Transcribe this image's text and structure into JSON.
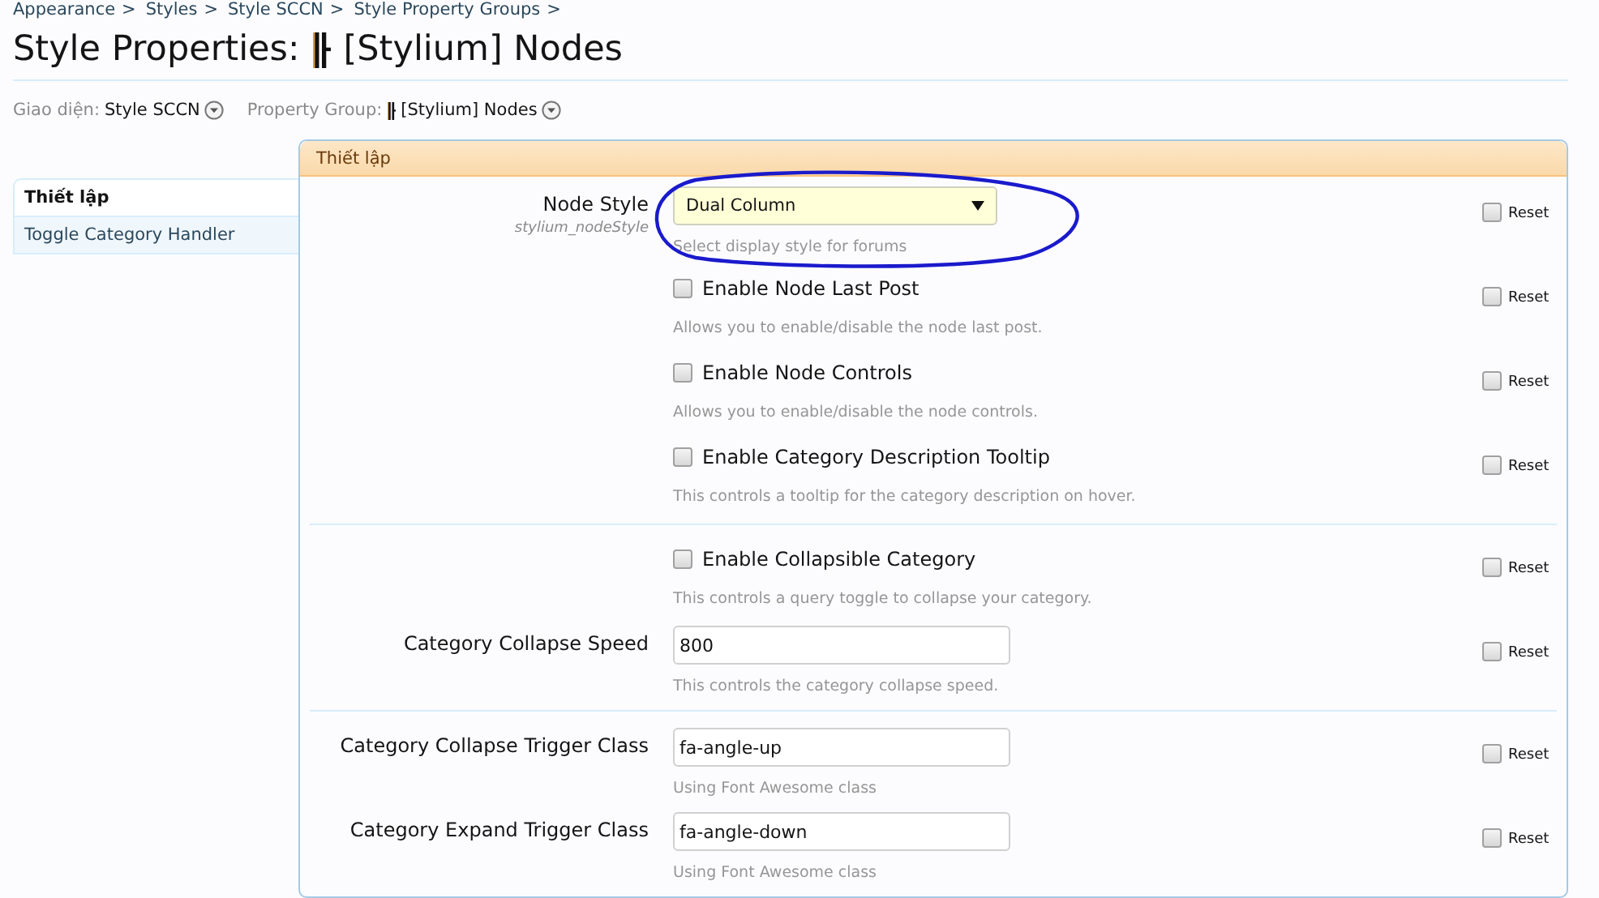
{
  "breadcrumbs": {
    "separator": ">",
    "items": [
      "Appearance",
      "Styles",
      "Style SCCN",
      "Style Property Groups"
    ]
  },
  "title": {
    "prefix": "Style Properties:",
    "group": "[Stylium] Nodes"
  },
  "filters": [
    {
      "kind": "style",
      "label": "Giao diện:",
      "value": "Style SCCN"
    },
    {
      "kind": "group",
      "label": "Property Group:",
      "value": "[Stylium] Nodes"
    }
  ],
  "sidebar": {
    "tabs": [
      {
        "label": "Thiết lập",
        "selected": true
      },
      {
        "label": "Toggle Category Handler",
        "selected": false
      }
    ]
  },
  "panel": {
    "header": "Thiết lập",
    "sections": [
      [
        {
          "kind": "select",
          "label": "Node Style",
          "property_name": "stylium_nodeStyle",
          "value": "Dual Column",
          "hint": "Select display style for forums",
          "circled": true,
          "reset": {
            "label": "Reset",
            "checked": false
          }
        },
        {
          "kind": "checkbox",
          "label": "Enable Node Last Post",
          "checked": false,
          "hint": "Allows you to enable/disable the node last post.",
          "circled": false,
          "reset": {
            "label": "Reset",
            "checked": false
          }
        },
        {
          "kind": "checkbox",
          "label": "Enable Node Controls",
          "checked": false,
          "hint": "Allows you to enable/disable the node controls.",
          "circled": false,
          "reset": {
            "label": "Reset",
            "checked": false
          }
        },
        {
          "kind": "checkbox",
          "label": "Enable Category Description Tooltip",
          "checked": false,
          "hint": "This controls a tooltip for the category description on hover.",
          "circled": false,
          "reset": {
            "label": "Reset",
            "checked": false
          }
        }
      ],
      [
        {
          "kind": "checkbox",
          "label": "Enable Collapsible Category",
          "checked": false,
          "hint": "This controls a query toggle to collapse your category.",
          "circled": false,
          "reset": {
            "label": "Reset",
            "checked": false
          }
        },
        {
          "kind": "text",
          "label": "Category Collapse Speed",
          "value": "800",
          "hint": "This controls the category collapse speed.",
          "circled": false,
          "reset": {
            "label": "Reset",
            "checked": false
          }
        }
      ],
      [
        {
          "kind": "text",
          "label": "Category Collapse Trigger Class",
          "value": "fa-angle-up",
          "hint": "Using Font Awesome class",
          "circled": false,
          "reset": {
            "label": "Reset",
            "checked": false
          }
        },
        {
          "kind": "text",
          "label": "Category Expand Trigger Class",
          "value": "fa-angle-down",
          "hint": "Using Font Awesome class",
          "circled": false,
          "reset": {
            "label": "Reset",
            "checked": false
          }
        }
      ]
    ]
  }
}
